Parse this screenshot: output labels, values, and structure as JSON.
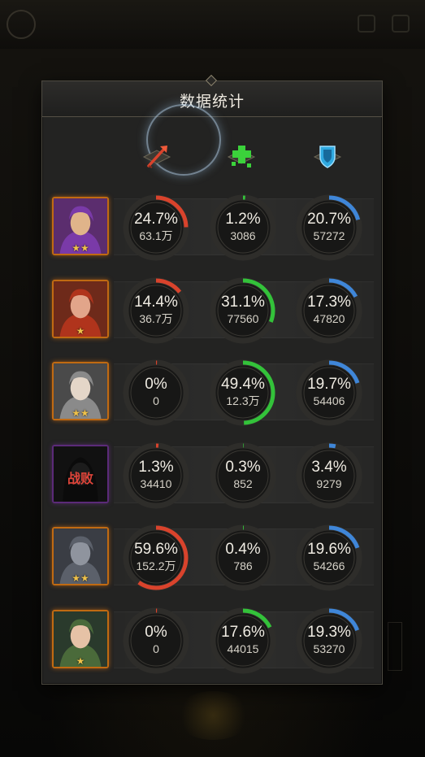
{
  "panel": {
    "title": "数据统计"
  },
  "columns": [
    {
      "name": "damage",
      "icon": "red-arrow-icon",
      "color": "#d9432c"
    },
    {
      "name": "healing",
      "icon": "green-cross-icon",
      "color": "#33c23a"
    },
    {
      "name": "shield",
      "icon": "blue-shield-icon",
      "color": "#3f86d8"
    }
  ],
  "heroes": [
    {
      "stars": "★★",
      "defeated": false,
      "portrait": "hero-1",
      "stats": [
        {
          "pct": "24.7%",
          "value": "63.1万",
          "fill": 0.247
        },
        {
          "pct": "1.2%",
          "value": "3086",
          "fill": 0.012
        },
        {
          "pct": "20.7%",
          "value": "57272",
          "fill": 0.207
        }
      ]
    },
    {
      "stars": "★",
      "defeated": false,
      "portrait": "hero-2",
      "stats": [
        {
          "pct": "14.4%",
          "value": "36.7万",
          "fill": 0.144
        },
        {
          "pct": "31.1%",
          "value": "77560",
          "fill": 0.311
        },
        {
          "pct": "17.3%",
          "value": "47820",
          "fill": 0.173
        }
      ]
    },
    {
      "stars": "★★",
      "defeated": false,
      "portrait": "hero-3",
      "stats": [
        {
          "pct": "0%",
          "value": "0",
          "fill": 0
        },
        {
          "pct": "49.4%",
          "value": "12.3万",
          "fill": 0.494
        },
        {
          "pct": "19.7%",
          "value": "54406",
          "fill": 0.197
        }
      ]
    },
    {
      "stars": "",
      "defeated": true,
      "defeat_label": "战败",
      "portrait": "hero-4",
      "stats": [
        {
          "pct": "1.3%",
          "value": "34410",
          "fill": 0.013
        },
        {
          "pct": "0.3%",
          "value": "852",
          "fill": 0.003
        },
        {
          "pct": "3.4%",
          "value": "9279",
          "fill": 0.034
        }
      ]
    },
    {
      "stars": "★★",
      "defeated": false,
      "portrait": "hero-5",
      "stats": [
        {
          "pct": "59.6%",
          "value": "152.2万",
          "fill": 0.596
        },
        {
          "pct": "0.4%",
          "value": "786",
          "fill": 0.004
        },
        {
          "pct": "19.6%",
          "value": "54266",
          "fill": 0.196
        }
      ]
    },
    {
      "stars": "★",
      "defeated": false,
      "portrait": "hero-6",
      "stats": [
        {
          "pct": "0%",
          "value": "0",
          "fill": 0
        },
        {
          "pct": "17.6%",
          "value": "44015",
          "fill": 0.176
        },
        {
          "pct": "19.3%",
          "value": "53270",
          "fill": 0.193
        }
      ]
    }
  ]
}
